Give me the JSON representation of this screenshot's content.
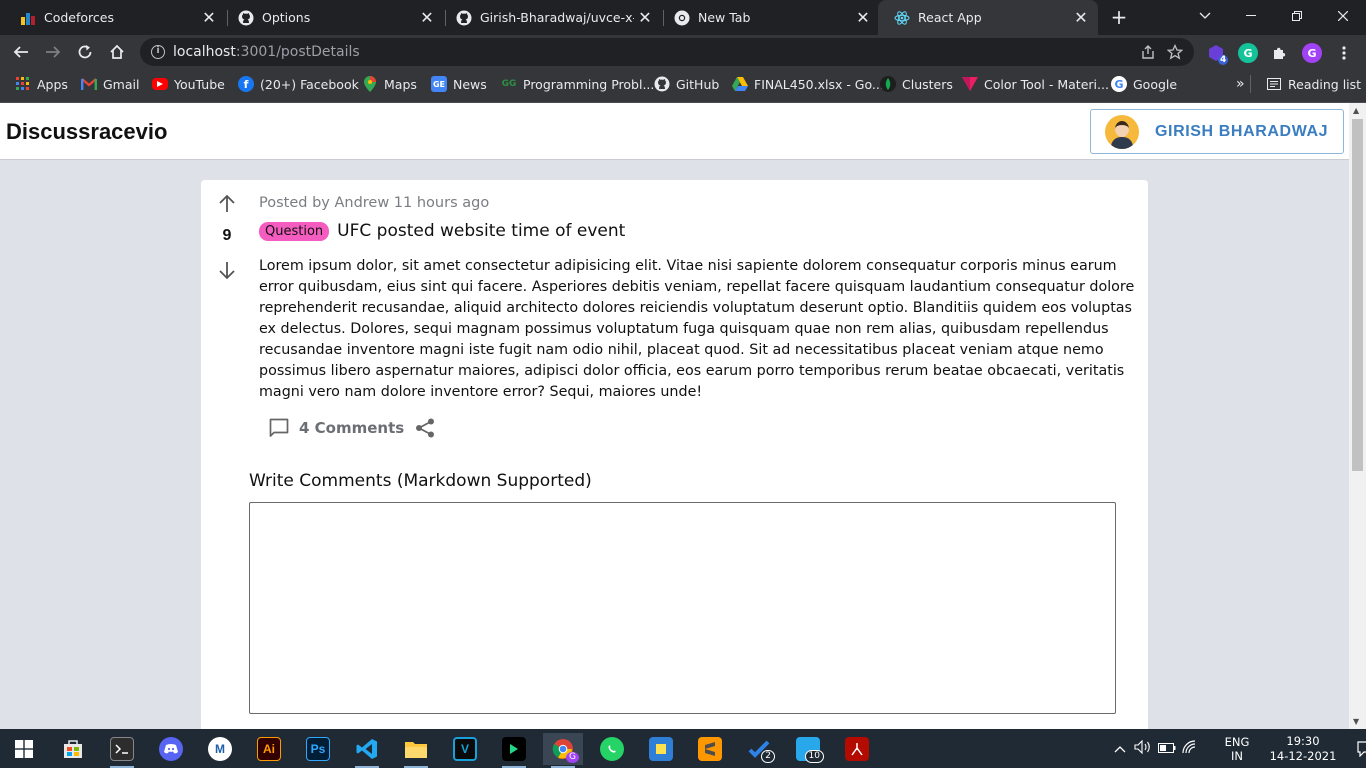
{
  "browser": {
    "tabs": [
      {
        "title": "Codeforces",
        "icon": "codeforces-icon",
        "active": false
      },
      {
        "title": "Options",
        "icon": "github-icon",
        "active": false
      },
      {
        "title": "Girish-Bharadwaj/uvce-x-clie",
        "icon": "github-icon",
        "active": false
      },
      {
        "title": "New Tab",
        "icon": "chrome-icon",
        "active": false
      },
      {
        "title": "React App",
        "icon": "react-icon",
        "active": true
      }
    ],
    "url_host": "localhost",
    "url_rest": ":3001/postDetails",
    "extension_badge": "4",
    "profile_initial": "G",
    "grammarly_initial": "G",
    "bookmarks": [
      {
        "label": "Apps",
        "icon": "apps-grid-icon"
      },
      {
        "label": "Gmail",
        "icon": "gmail-icon"
      },
      {
        "label": "YouTube",
        "icon": "youtube-icon"
      },
      {
        "label": "(20+) Facebook",
        "icon": "facebook-icon"
      },
      {
        "label": "Maps",
        "icon": "maps-icon"
      },
      {
        "label": "News",
        "icon": "news-icon"
      },
      {
        "label": "Programming Probl...",
        "icon": "gfg-icon"
      },
      {
        "label": "GitHub",
        "icon": "github-icon"
      },
      {
        "label": "FINAL450.xlsx - Go...",
        "icon": "drive-icon"
      },
      {
        "label": "Clusters",
        "icon": "mongodb-icon"
      },
      {
        "label": "Color Tool - Materi...",
        "icon": "material-icon"
      },
      {
        "label": "Google",
        "icon": "google-icon"
      }
    ],
    "more_bookmarks": "»",
    "reading_list": "Reading list"
  },
  "app": {
    "brand": "Discussracevio",
    "user_name": "GIRISH BHARADWAJ"
  },
  "post": {
    "meta": "Posted by Andrew 11 hours ago",
    "votes": "9",
    "tag": "Question",
    "title": "UFC posted website time of event",
    "body": "Lorem ipsum dolor, sit amet consectetur adipisicing elit. Vitae nisi sapiente dolorem consequatur corporis minus earum error quibusdam, eius sint qui facere. Asperiores debitis veniam, repellat facere quisquam laudantium consequatur dolore reprehenderit recusandae, aliquid architecto dolores reiciendis voluptatum deserunt optio. Blanditiis quidem eos voluptas ex delectus. Dolores, sequi magnam possimus voluptatum fuga quisquam quae non rem alias, quibusdam repellendus recusandae inventore magni iste fugit nam odio nihil, placeat quod. Sit ad necessitatibus placeat veniam atque nemo possimus libero aspernatur maiores, adipisci dolor officia, eos earum porro temporibus rerum beatae obcaecati, veritatis magni vero nam dolore inventore error? Sequi, maiores unde!",
    "comments_label": "4 Comments",
    "write_comments_label": "Write Comments (Markdown Supported)",
    "comment_value": ""
  },
  "taskbar": {
    "chrome_badge": "G",
    "todo_badge": "2",
    "files_badge": "10",
    "language": "ENG",
    "region": "IN",
    "time": "19:30",
    "date": "14-12-2021"
  },
  "colors": {
    "tag_bg": "#f45dbf",
    "user_accent": "#3a7dc0",
    "page_bg": "#dee1e7"
  }
}
